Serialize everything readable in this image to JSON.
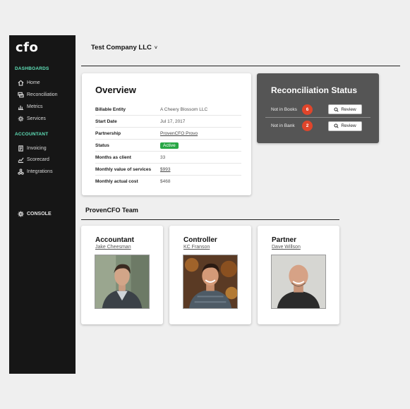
{
  "sidebar": {
    "logo": "cfo",
    "sections": [
      {
        "label": "DASHBOARDS",
        "items": [
          {
            "label": "Home",
            "icon": "home-icon"
          },
          {
            "label": "Reconciliation",
            "icon": "reconciliation-icon"
          },
          {
            "label": "Metrics",
            "icon": "bar-chart-icon"
          },
          {
            "label": "Services",
            "icon": "gear-icon"
          }
        ]
      },
      {
        "label": "ACCOUNTANT",
        "items": [
          {
            "label": "Invoicing",
            "icon": "invoice-icon"
          },
          {
            "label": "Scorecard",
            "icon": "line-chart-icon"
          },
          {
            "label": "Integrations",
            "icon": "integrations-icon"
          }
        ]
      }
    ],
    "console_label": "CONSOLE"
  },
  "header": {
    "company": "Test Company LLC",
    "chevron": "˅"
  },
  "overview": {
    "title": "Overview",
    "rows": [
      {
        "key": "Billable Entity",
        "value": "A Cheery Blossom LLC"
      },
      {
        "key": "Start Date",
        "value": "Jul 17, 2017"
      },
      {
        "key": "Partnership",
        "value": "ProvenCFO Provo"
      },
      {
        "key": "Status",
        "value": "Active"
      },
      {
        "key": "Months as client",
        "value": "33"
      },
      {
        "key": "Monthly value of services",
        "value": "$993"
      },
      {
        "key": "Monthly actual cost",
        "value": "$468"
      }
    ]
  },
  "reconciliation": {
    "title": "Reconciliation Status",
    "rows": [
      {
        "label": "Not in Books",
        "count": "6",
        "button": "Review"
      },
      {
        "label": "Not in Bank",
        "count": "2",
        "button": "Review"
      }
    ]
  },
  "team": {
    "title": "ProvenCFO Team",
    "members": [
      {
        "role": "Accountant",
        "name": "Jake Cheesman"
      },
      {
        "role": "Controller",
        "name": "KC Franson"
      },
      {
        "role": "Partner",
        "name": "Dave Willson"
      }
    ]
  },
  "colors": {
    "accent": "#5fe0b8",
    "badge_red": "#e0452b",
    "active_green": "#28a745",
    "sidebar_bg": "#161616"
  }
}
